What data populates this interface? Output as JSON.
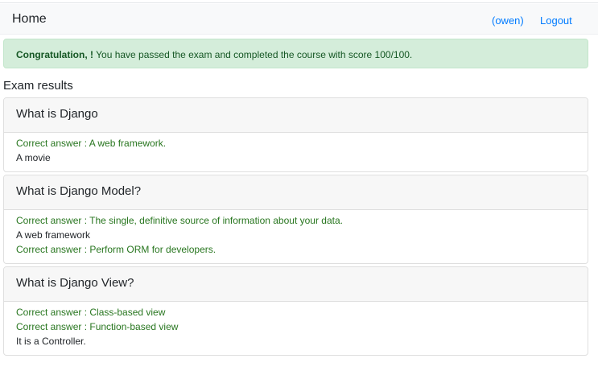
{
  "navbar": {
    "brand": "Home",
    "user": "(owen)",
    "logout": "Logout"
  },
  "alert": {
    "strong": "Congratulation, !",
    "text": " You have passed the exam and completed the course with score 100/100."
  },
  "section_title": "Exam results",
  "questions": [
    {
      "title": "What is Django",
      "answers": [
        {
          "text": "Correct answer : A web framework.",
          "correct": true
        },
        {
          "text": "A movie",
          "correct": false
        }
      ]
    },
    {
      "title": "What is Django Model?",
      "answers": [
        {
          "text": "Correct answer : The single, definitive source of information about your data.",
          "correct": true
        },
        {
          "text": "A web framework",
          "correct": false
        },
        {
          "text": "Correct answer : Perform ORM for developers.",
          "correct": true
        }
      ]
    },
    {
      "title": "What is Django View?",
      "answers": [
        {
          "text": "Correct answer : Class-based view",
          "correct": true
        },
        {
          "text": "Correct answer : Function-based view",
          "correct": true
        },
        {
          "text": "It is a Controller.",
          "correct": false
        }
      ]
    }
  ],
  "colors": {
    "link": "#007bff",
    "alert_bg": "#d4edda",
    "correct": "#28761f"
  }
}
